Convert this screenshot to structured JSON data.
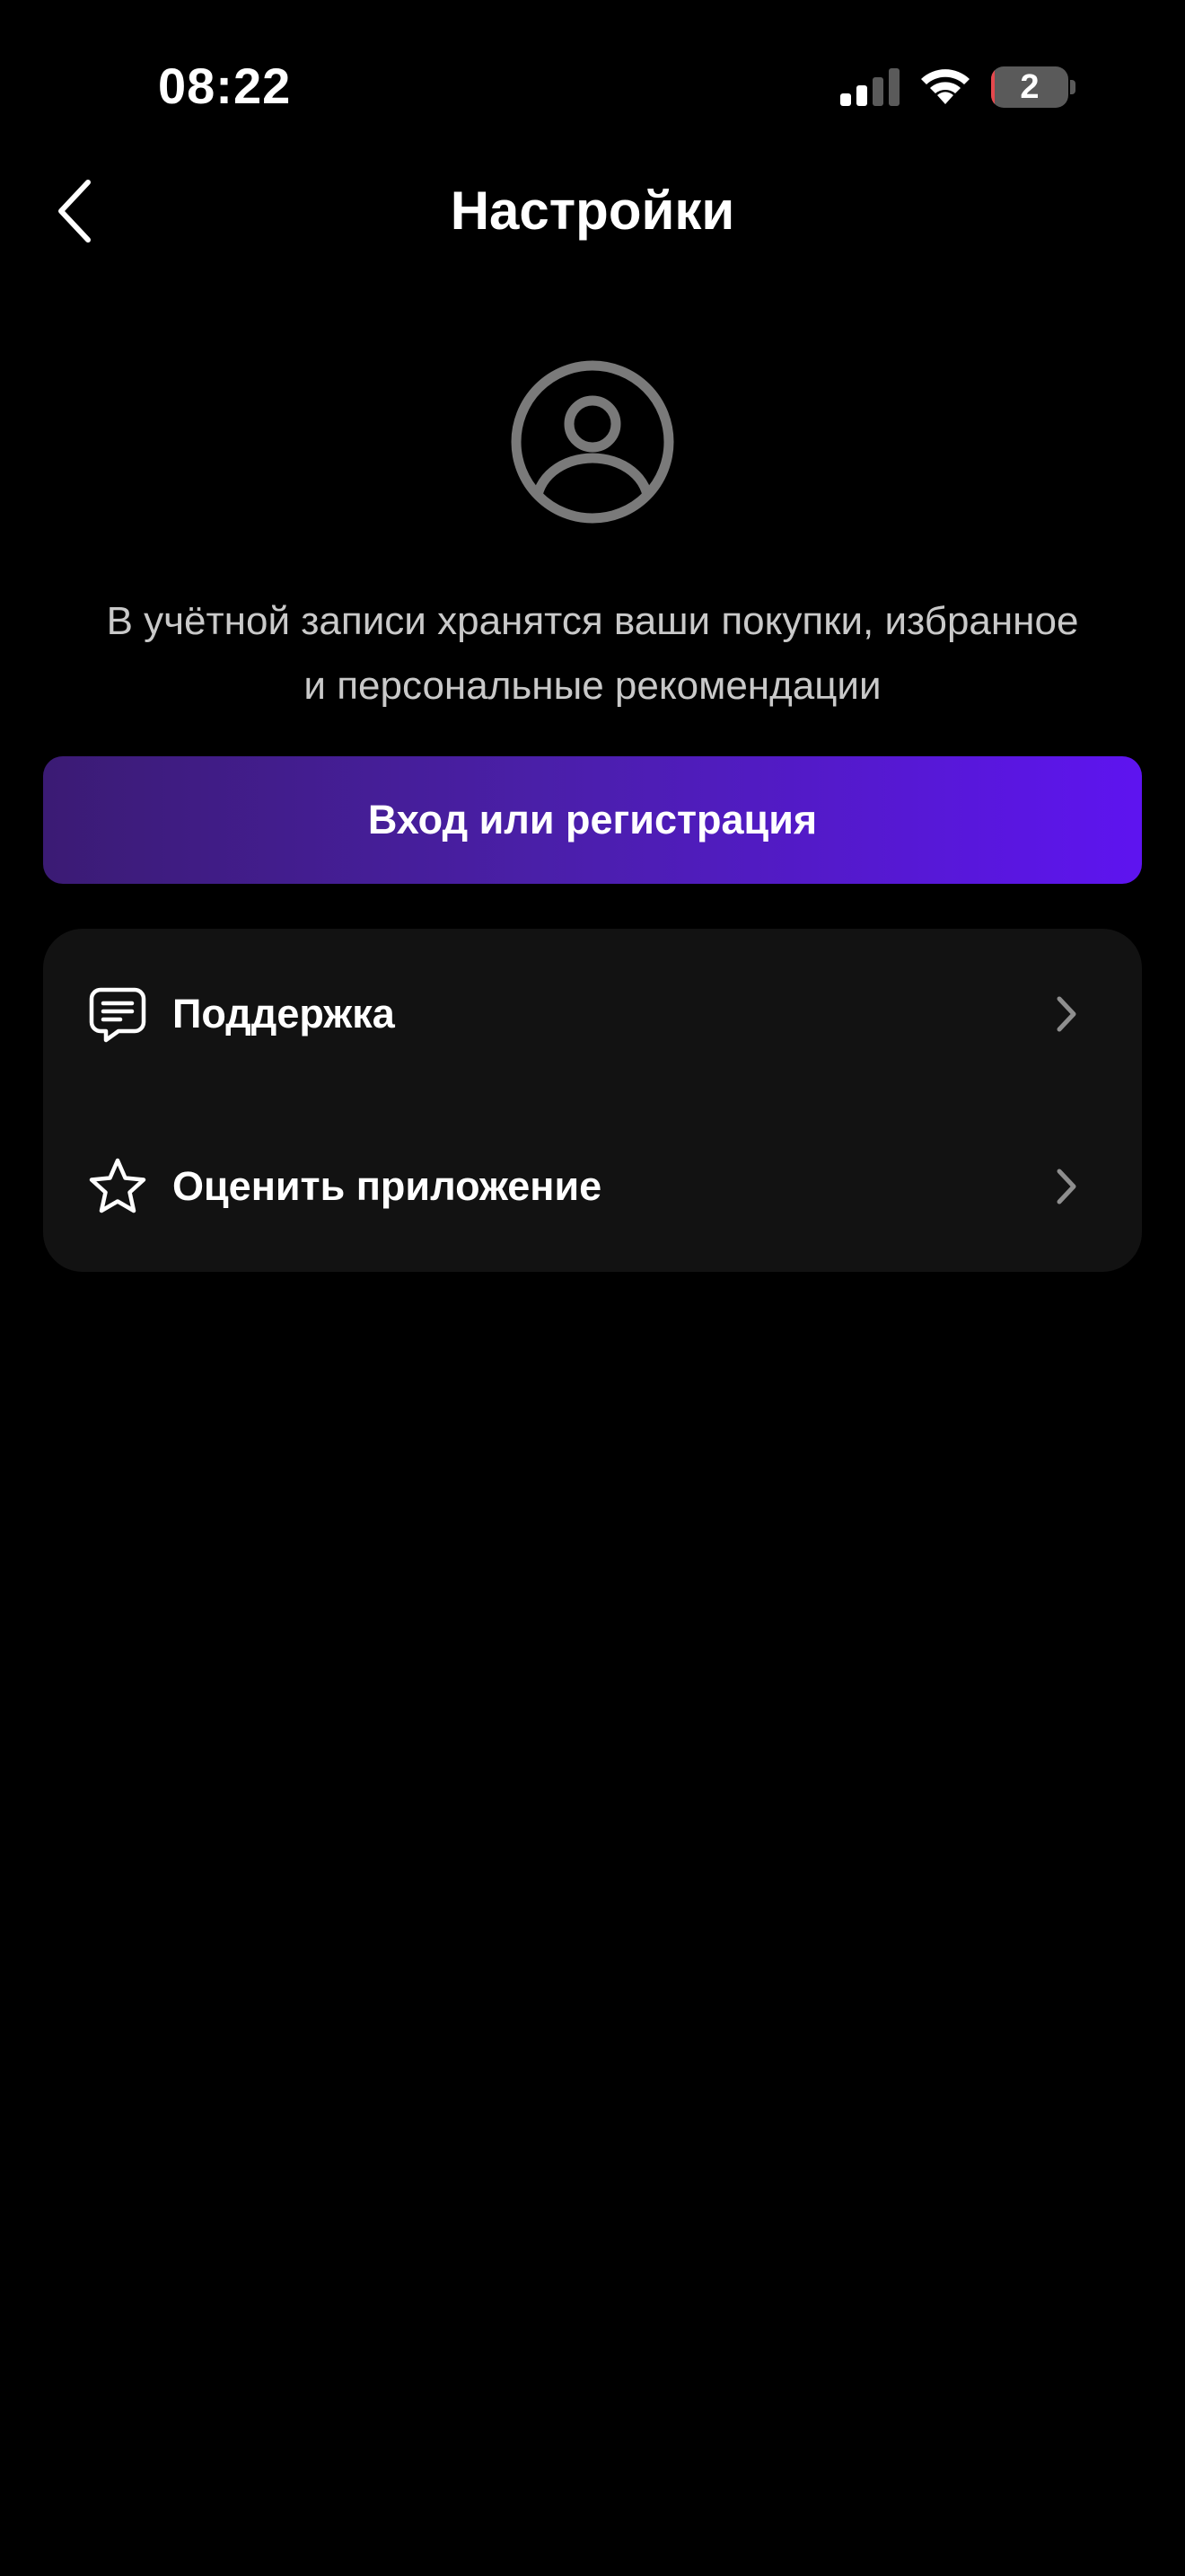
{
  "status_bar": {
    "time": "08:22",
    "battery_text": "2",
    "battery_level_percent": 2,
    "icons": [
      "cellular-signal-icon",
      "wifi-icon",
      "battery-icon"
    ]
  },
  "nav": {
    "title": "Настройки",
    "back_icon": "chevron-left-icon"
  },
  "account": {
    "avatar_icon": "user-circle-icon",
    "info_line_1": "В учётной записи хранятся ваши покупки, избранное",
    "info_line_2": "и персональные рекомендации",
    "login_button_label": "Вход или регистрация"
  },
  "menu": {
    "items": [
      {
        "label": "Поддержка",
        "icon": "chat-message-icon",
        "chevron": "chevron-right-icon"
      },
      {
        "label": "Оценить приложение",
        "icon": "star-icon",
        "chevron": "chevron-right-icon"
      }
    ]
  },
  "colors": {
    "background": "#000000",
    "card": "#121212",
    "button_gradient_start": "#3b1b74",
    "button_gradient_end": "#5e14f0",
    "secondary_text": "#c9c9c9",
    "icon_gray": "#7a7a7a",
    "battery_low": "#e5484d"
  }
}
